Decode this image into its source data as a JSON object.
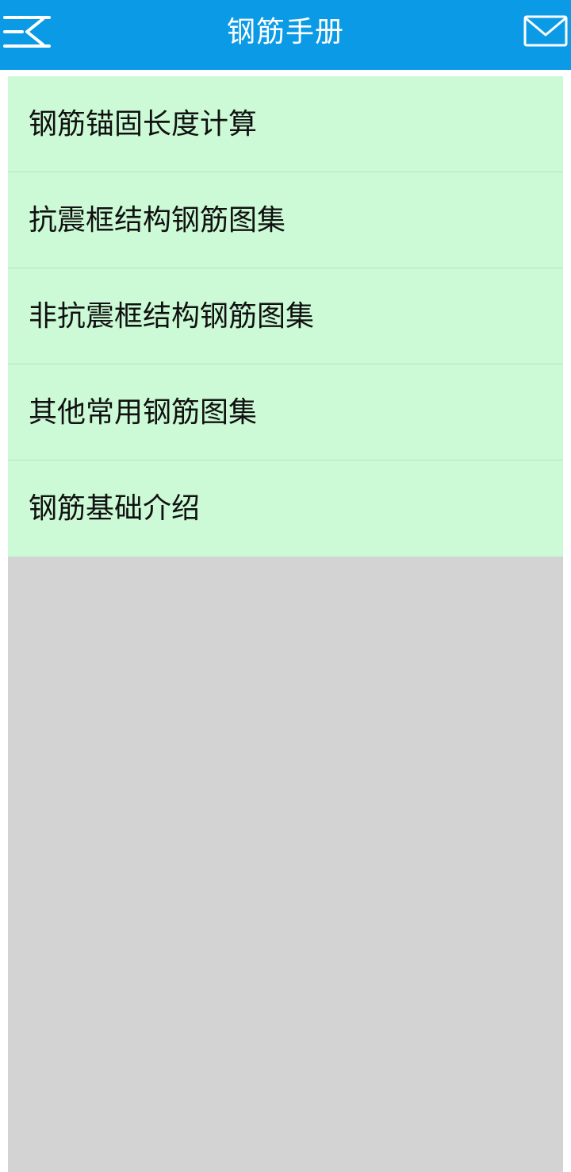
{
  "header": {
    "title": "钢筋手册",
    "menu_icon": "menu-collapse-icon",
    "mail_icon": "mail-icon",
    "background_color": "#0b9be6"
  },
  "menu": {
    "items": [
      {
        "label": "钢筋锚固长度计算"
      },
      {
        "label": "抗震框结构钢筋图集"
      },
      {
        "label": "非抗震框结构钢筋图集"
      },
      {
        "label": "其他常用钢筋图集"
      },
      {
        "label": "钢筋基础介绍"
      }
    ],
    "row_color": "#ccfad6"
  },
  "content": {
    "background_color": "#d3d3d3"
  }
}
